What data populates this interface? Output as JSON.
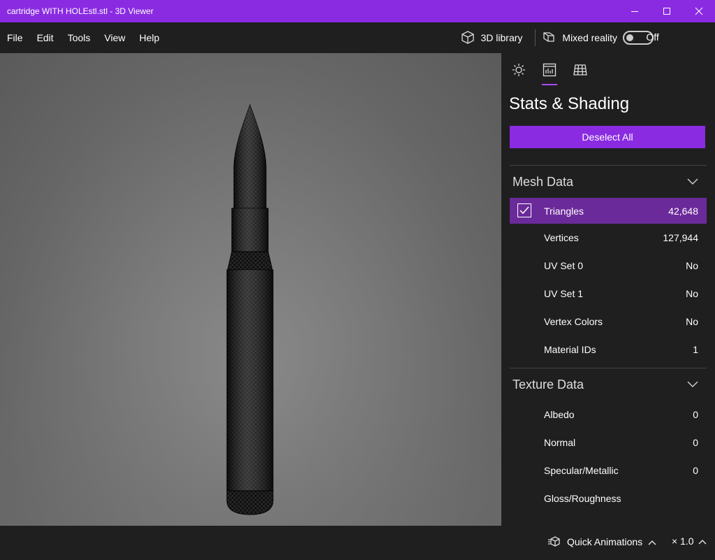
{
  "window": {
    "title": "cartridge WITH HOLEstl.stl - 3D Viewer",
    "accent_color": "#8a2be2"
  },
  "menu": {
    "items": [
      "File",
      "Edit",
      "Tools",
      "View",
      "Help"
    ],
    "library_label": "3D library",
    "mixed_reality_label": "Mixed reality",
    "mixed_reality_state": "Off"
  },
  "panel": {
    "tabs": [
      {
        "icon": "lighting-icon"
      },
      {
        "icon": "stats-icon",
        "active": true
      },
      {
        "icon": "grid-icon"
      }
    ],
    "title": "Stats & Shading",
    "deselect_label": "Deselect All",
    "mesh_section": {
      "title": "Mesh Data",
      "rows": [
        {
          "label": "Triangles",
          "value": "42,648",
          "selected": true,
          "checked": true
        },
        {
          "label": "Vertices",
          "value": "127,944"
        },
        {
          "label": "UV Set 0",
          "value": "No"
        },
        {
          "label": "UV Set 1",
          "value": "No"
        },
        {
          "label": "Vertex Colors",
          "value": "No"
        },
        {
          "label": "Material IDs",
          "value": "1"
        }
      ]
    },
    "texture_section": {
      "title": "Texture Data",
      "rows": [
        {
          "label": "Albedo",
          "value": "0"
        },
        {
          "label": "Normal",
          "value": "0"
        },
        {
          "label": "Specular/Metallic",
          "value": "0"
        },
        {
          "label": "Gloss/Roughness",
          "value": ""
        }
      ]
    }
  },
  "bottom": {
    "quick_animations_label": "Quick Animations",
    "speed_label": "× 1.0"
  }
}
